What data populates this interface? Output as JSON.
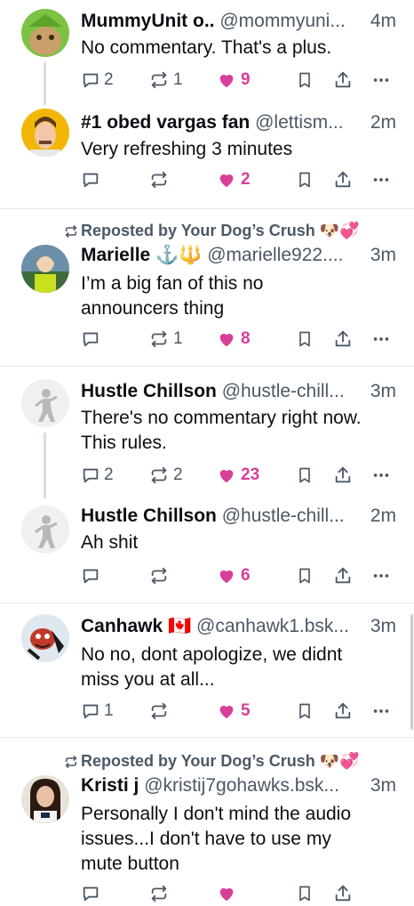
{
  "posts": [
    {
      "display_name": "MummyUnit o..",
      "handle": "@mommyuni...",
      "time": "4m",
      "text": [
        "No commentary. That's a plus."
      ],
      "replies": "2",
      "reposts": "1",
      "likes": "9"
    },
    {
      "display_name": "#1 obed vargas fan",
      "handle": "@lettism...",
      "time": "2m",
      "text": [
        "Very refreshing 3 minutes"
      ],
      "replies": "",
      "reposts": "",
      "likes": "2"
    },
    {
      "reposted_by": "Reposted by Your Dog’s Crush 🐶💞",
      "display_name": "Marielle ⚓🔱",
      "handle": "@marielle922....",
      "time": "3m",
      "text": [
        "I’m a big fan of this no",
        "announcers thing"
      ],
      "replies": "",
      "reposts": "1",
      "likes": "8"
    },
    {
      "display_name": "Hustle Chillson",
      "handle": "@hustle-chill...",
      "time": "3m",
      "text": [
        "There's no commentary right now.",
        "This rules."
      ],
      "replies": "2",
      "reposts": "2",
      "likes": "23"
    },
    {
      "display_name": "Hustle Chillson",
      "handle": "@hustle-chill...",
      "time": "2m",
      "text": [
        "Ah shit"
      ],
      "replies": "",
      "reposts": "",
      "likes": "6"
    },
    {
      "display_name": "Canhawk 🇨🇦",
      "handle": "@canhawk1.bsk...",
      "time": "3m",
      "text": [
        "No no, dont apologize, we didnt",
        "miss you at all..."
      ],
      "replies": "1",
      "reposts": "",
      "likes": "5"
    },
    {
      "reposted_by": "Reposted by Your Dog’s Crush 🐶💞",
      "display_name": "Kristi j",
      "handle": "@kristij7gohawks.bsk...",
      "time": "3m",
      "text": [
        "Personally I don't mind the audio",
        "issues...I don't have to use my",
        "mute button"
      ],
      "replies": "",
      "reposts": "",
      "likes": ""
    }
  ],
  "colors": {
    "like": "#d73f9a",
    "meta": "#4b5866",
    "text": "#0b0f14",
    "separator": "#e3e7eb"
  },
  "icons": [
    "reply-icon",
    "repost-icon",
    "heart-icon",
    "bookmark-icon",
    "share-icon",
    "more-icon"
  ]
}
